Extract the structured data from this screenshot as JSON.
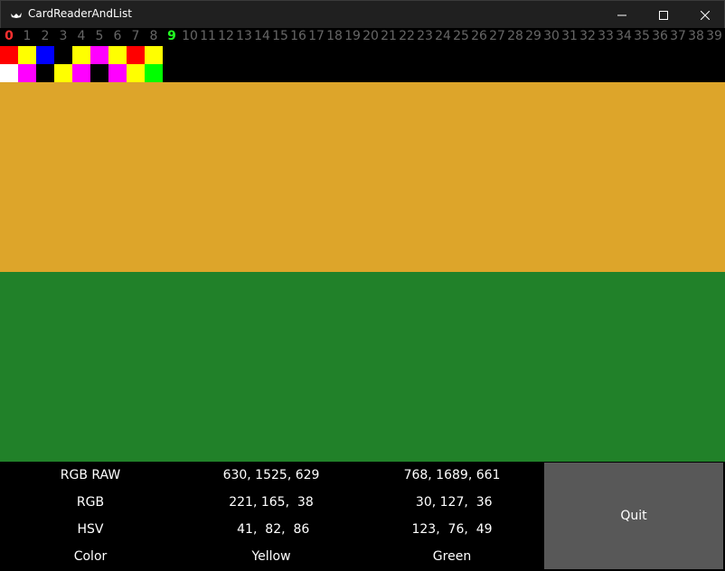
{
  "window": {
    "title": "CardReaderAndList",
    "icon": "app-bird-icon"
  },
  "number_strip": {
    "numbers": [
      "0",
      "1",
      "2",
      "3",
      "4",
      "5",
      "6",
      "7",
      "8",
      "9",
      "10",
      "11",
      "12",
      "13",
      "14",
      "15",
      "16",
      "17",
      "18",
      "19",
      "20",
      "21",
      "22",
      "23",
      "24",
      "25",
      "26",
      "27",
      "28",
      "29",
      "30",
      "31",
      "32",
      "33",
      "34",
      "35",
      "36",
      "37",
      "38",
      "39"
    ],
    "current_index": 0,
    "current_color": "#ff3030",
    "highlight_index": 9,
    "highlight_color": "#22ff22",
    "default_color": "#666666"
  },
  "card_grid": {
    "row_top": [
      "#ff0000",
      "#ffff00",
      "#0000ff",
      "#000000",
      "#ffff00",
      "#ff00ff",
      "#ffff00",
      "#ff0000",
      "#ffff00"
    ],
    "row_bottom": [
      "#ffffff",
      "#ff00ff",
      "#000000",
      "#ffff00",
      "#ff00ff",
      "#000000",
      "#ff00ff",
      "#ffff00",
      "#00ff00"
    ]
  },
  "bars": {
    "left_color": "#dda52a",
    "right_color": "#218129"
  },
  "info": {
    "rows": [
      {
        "label": "RGB RAW",
        "left": "630, 1525, 629",
        "right": "768, 1689, 661"
      },
      {
        "label": "RGB",
        "left": "221, 165,  38",
        "right": " 30, 127,  36"
      },
      {
        "label": "HSV",
        "left": " 41,  82,  86",
        "right": "123,  76,  49"
      },
      {
        "label": "Color",
        "left": "Yellow",
        "right": "Green"
      }
    ]
  },
  "quit": {
    "label": "Quit"
  }
}
